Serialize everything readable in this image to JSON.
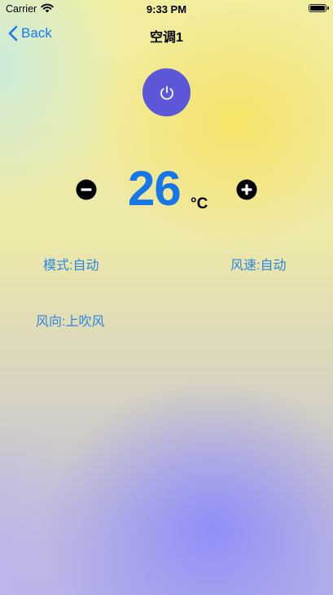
{
  "status_bar": {
    "carrier": "Carrier",
    "time": "9:33 PM",
    "battery_level": 1.0
  },
  "nav": {
    "back_label": "Back",
    "title": "空调1"
  },
  "controls": {
    "power_icon": "power-icon",
    "temperature": "26",
    "unit": "°C",
    "minus_icon": "minus-circle-icon",
    "plus_icon": "plus-circle-icon"
  },
  "settings": {
    "mode": "模式:自动",
    "fan_speed": "风速:自动",
    "wind_direction": "风向:上吹风"
  },
  "colors": {
    "accent": "#1a7cf0",
    "power_button": "#5b57d8",
    "temperature": "#1577e8"
  }
}
